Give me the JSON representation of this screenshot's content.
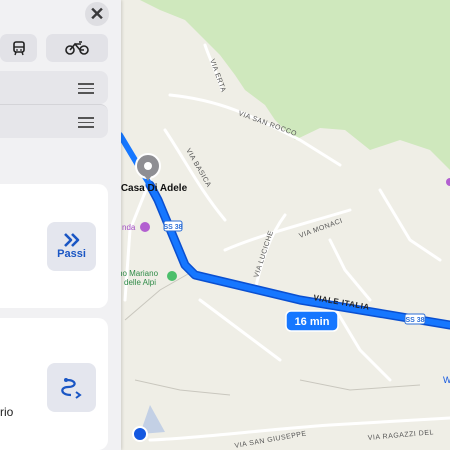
{
  "panel": {
    "close_glyph": "✕",
    "modes": [
      {
        "icon": "train-icon"
      },
      {
        "icon": "bicycle-icon"
      }
    ],
    "steps_label": "Passi",
    "partial_text": "rio"
  },
  "map": {
    "place_name": "Casa Di Adele",
    "nearby_poi_1": "nda",
    "nearby_poi_2": "no Mariano\ndelle Alpi",
    "route_time": "16 min",
    "shields": {
      "ss38_a": "SS 38",
      "ss38_b": "SS 38"
    },
    "roads": {
      "viale_italia": "VIALE ITALIA",
      "via_san_rocco": "VIA SAN ROCCO",
      "via_basica": "VIA BASICA",
      "via_monaci": "VIA MONACI",
      "via_luciche": "VIA LUCICHE",
      "via_erta": "VIA ERTA",
      "via_san_giuseppe": "VIA SAN GIUSEPPE",
      "via_ragazzi_del": "VIA RAGAZZI DEL",
      "edge_w": "W"
    },
    "colors": {
      "route": "#1677ff",
      "route_border": "#0a4fd0",
      "forest": "#cfe8bd",
      "user_location": "#1458e0"
    }
  }
}
